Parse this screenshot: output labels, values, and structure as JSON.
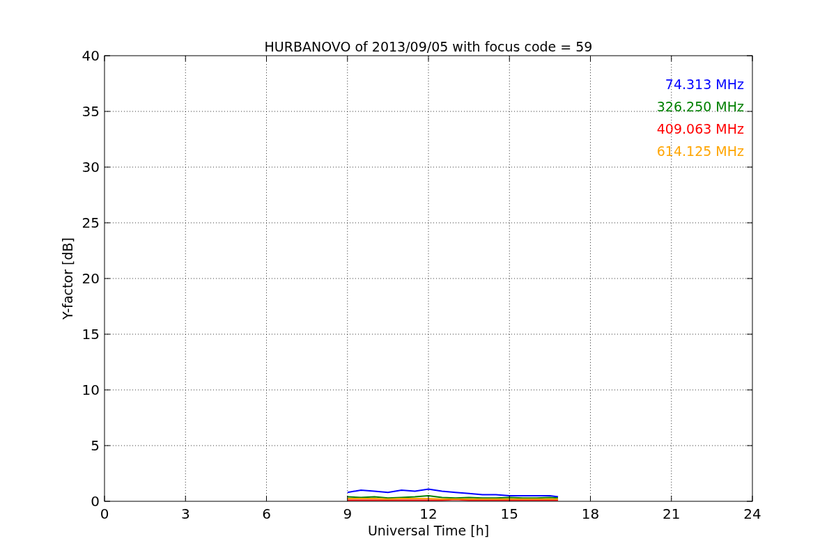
{
  "chart_data": {
    "type": "line",
    "title": "HURBANOVO of 2013/09/05 with focus code = 59",
    "xlabel": "Universal Time [h]",
    "ylabel": "Y-factor [dB]",
    "x": [
      9,
      9.5,
      10,
      10.5,
      11,
      11.5,
      12,
      12.5,
      13,
      13.5,
      14,
      14.5,
      15,
      15.5,
      16,
      16.5,
      16.8
    ],
    "series": [
      {
        "name": "74.313 MHz",
        "color": "#0000ff",
        "values": [
          0.8,
          1.0,
          0.9,
          0.8,
          1.0,
          0.9,
          1.1,
          0.9,
          0.8,
          0.7,
          0.6,
          0.6,
          0.5,
          0.5,
          0.5,
          0.5,
          0.4
        ]
      },
      {
        "name": "326.250 MHz",
        "color": "#008000",
        "values": [
          0.4,
          0.35,
          0.4,
          0.3,
          0.35,
          0.4,
          0.5,
          0.35,
          0.3,
          0.35,
          0.3,
          0.3,
          0.35,
          0.3,
          0.3,
          0.35,
          0.3
        ]
      },
      {
        "name": "409.063 MHz",
        "color": "#ff0000",
        "values": [
          0.1,
          0.1,
          0.1,
          0.1,
          0.1,
          0.1,
          0.1,
          0.1,
          0.15,
          0.1,
          0.1,
          0.1,
          0.1,
          0.1,
          0.1,
          0.1,
          0.1
        ]
      },
      {
        "name": "614.125 MHz",
        "color": "#ffa500",
        "values": [
          0.25,
          0.25,
          0.25,
          0.2,
          0.25,
          0.25,
          0.25,
          0.2,
          0.2,
          0.2,
          0.2,
          0.2,
          0.2,
          0.2,
          0.2,
          0.2,
          0.2
        ]
      }
    ],
    "grid": true,
    "xlim": [
      0,
      24
    ],
    "ylim": [
      0,
      40
    ],
    "xticks": [
      0,
      3,
      6,
      9,
      12,
      15,
      18,
      21,
      24
    ],
    "yticks": [
      0,
      5,
      10,
      15,
      20,
      25,
      30,
      35,
      40
    ]
  }
}
